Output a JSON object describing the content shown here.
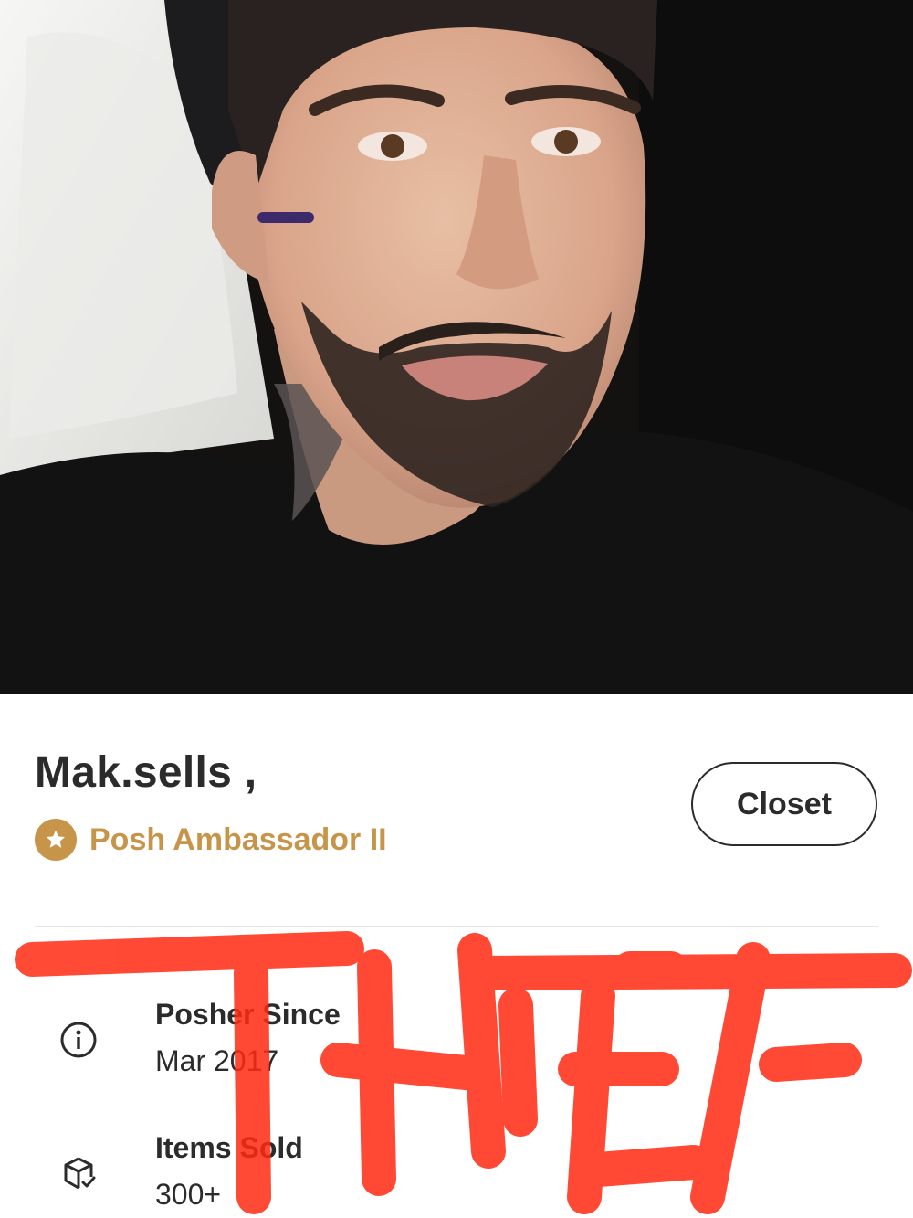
{
  "profile": {
    "username": "Mak.sells ,",
    "badge": {
      "icon": "star-badge-icon",
      "label": "Posh Ambassador II",
      "color": "#c7954a"
    },
    "closet_button_label": "Closet"
  },
  "stats": [
    {
      "icon": "info-icon",
      "label": "Posher Since",
      "value": "Mar 2017"
    },
    {
      "icon": "package-check-icon",
      "label": "Items Sold",
      "value": "300+"
    }
  ],
  "overlay": {
    "text": "THIEF",
    "color": "#ff2a12"
  }
}
